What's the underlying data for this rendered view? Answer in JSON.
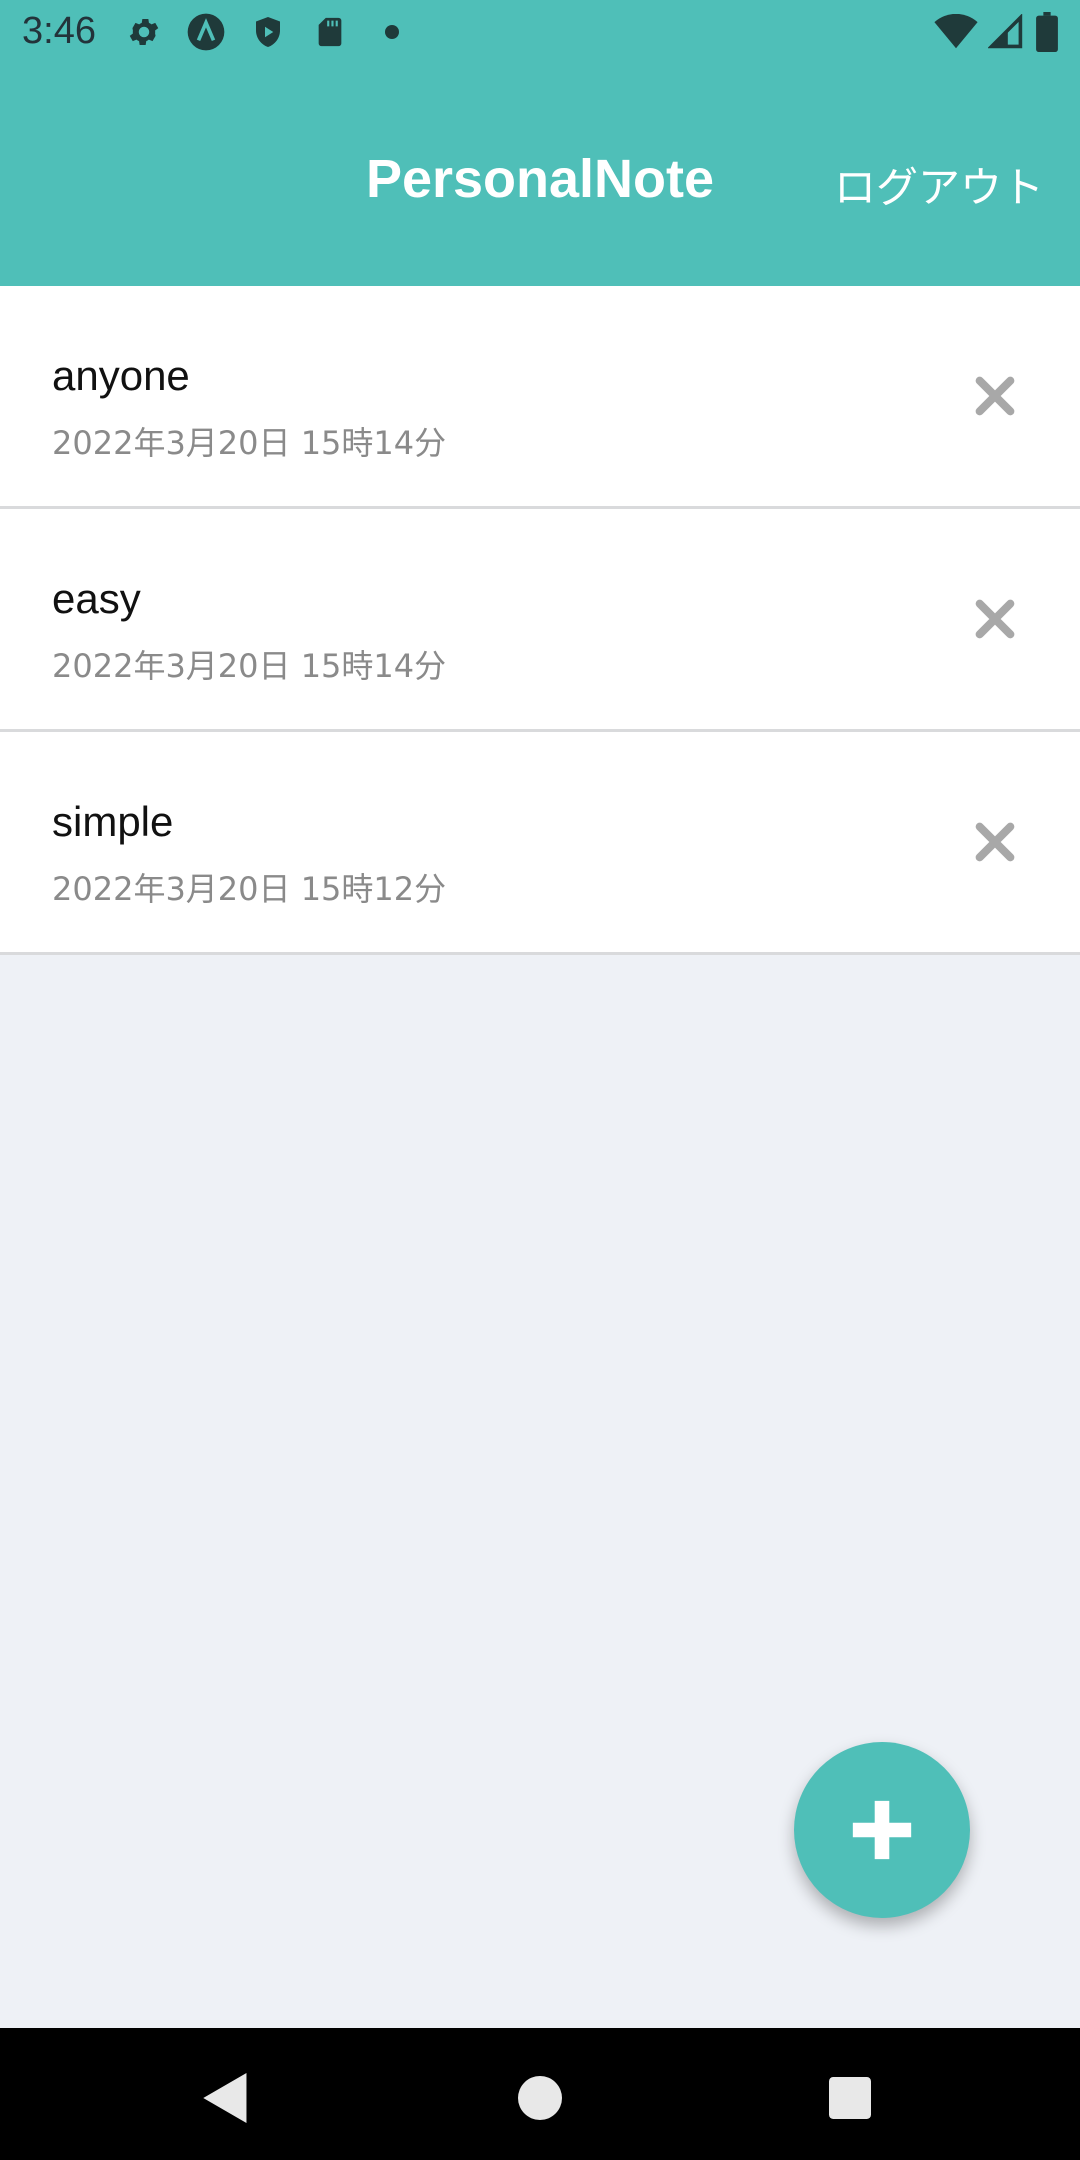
{
  "status_bar": {
    "time": "3:46",
    "left_icons": [
      "gear-icon",
      "app-a-icon",
      "shield-play-icon",
      "sd-card-icon",
      "dot-icon"
    ],
    "right_icons": [
      "wifi-icon",
      "signal-icon",
      "battery-icon"
    ]
  },
  "app_bar": {
    "title": "PersonalNote",
    "logout_label": "ログアウト",
    "color": "#4fbfb8"
  },
  "notes": [
    {
      "title": "anyone",
      "date": "2022年3月20日 15時14分"
    },
    {
      "title": "easy",
      "date": "2022年3月20日 15時14分"
    },
    {
      "title": "simple",
      "date": "2022年3月20日 15時12分"
    }
  ],
  "icons": {
    "delete": "close-icon",
    "fab": "plus-icon",
    "nav": [
      "back-icon",
      "home-icon",
      "recents-icon"
    ]
  }
}
